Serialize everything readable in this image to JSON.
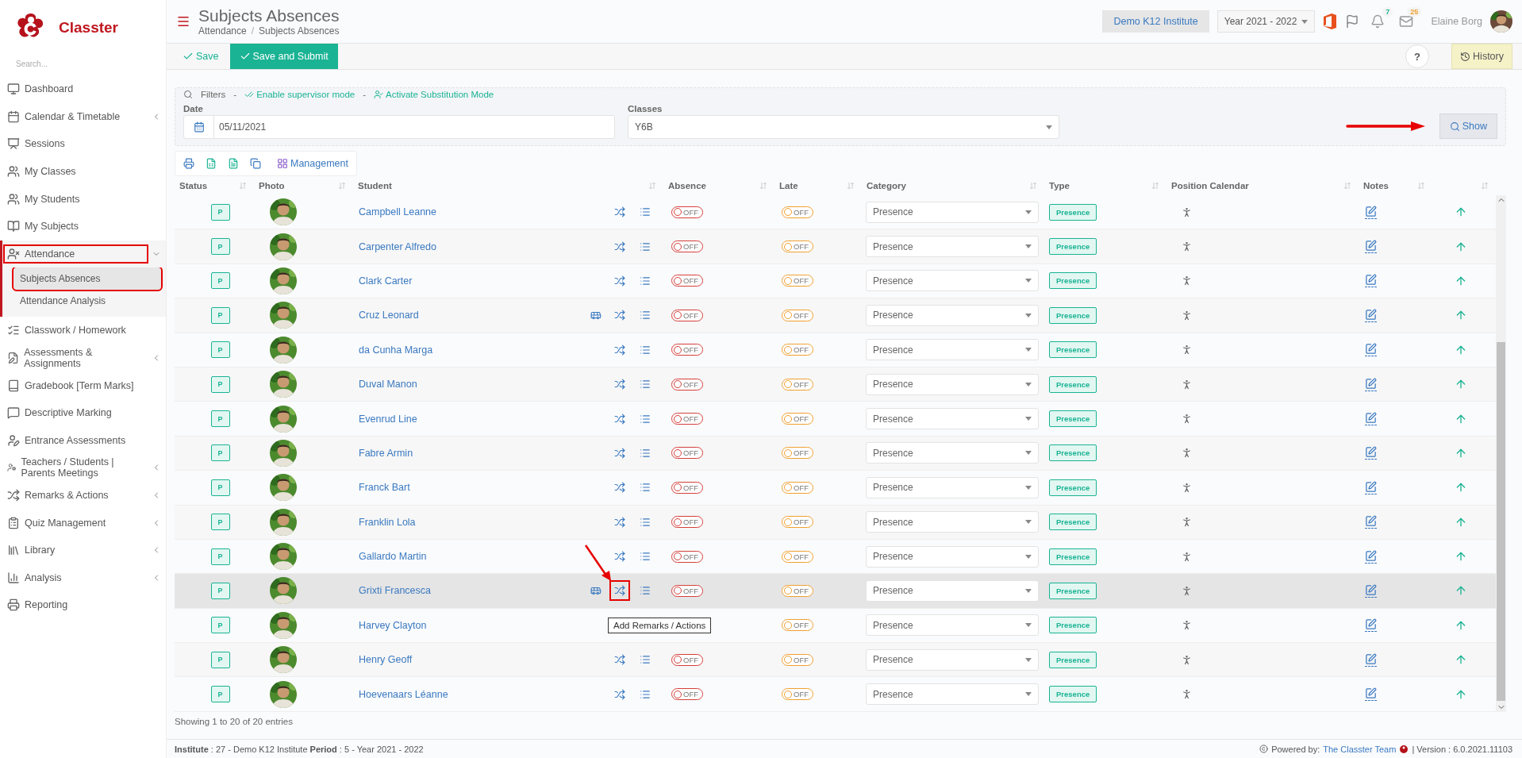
{
  "sidebar": {
    "logo": "Classter",
    "search": {
      "placeholder": "Search..."
    },
    "items": [
      {
        "label": "Dashboard",
        "kind": "link",
        "selected": false,
        "annotated": false
      },
      {
        "label": "Calendar & Timetable",
        "kind": "group",
        "expanded": false,
        "selected": false,
        "annotated": false
      },
      {
        "label": "Sessions",
        "kind": "link",
        "selected": false,
        "annotated": false
      },
      {
        "label": "My Classes",
        "kind": "link",
        "selected": false,
        "annotated": false
      },
      {
        "label": "My Students",
        "kind": "link",
        "selected": false,
        "annotated": false
      },
      {
        "label": "My Subjects",
        "kind": "link",
        "selected": false,
        "annotated": false
      },
      {
        "label": "Attendance",
        "kind": "group",
        "expanded": true,
        "selected": true,
        "annotated": true,
        "children": [
          {
            "label": "Subjects Absences",
            "selected": true,
            "annotated": true
          },
          {
            "label": "Attendance Analysis",
            "selected": false,
            "annotated": false
          }
        ]
      },
      {
        "label": "Classwork / Homework",
        "kind": "link",
        "selected": false,
        "annotated": false
      },
      {
        "label": "Assessments & Assignments",
        "kind": "group",
        "expanded": false,
        "selected": false,
        "annotated": false
      },
      {
        "label": "Gradebook [Term Marks]",
        "kind": "link",
        "selected": false,
        "annotated": false
      },
      {
        "label": "Descriptive Marking",
        "kind": "link",
        "selected": false,
        "annotated": false
      },
      {
        "label": "Entrance Assessments",
        "kind": "link",
        "selected": false,
        "annotated": false
      },
      {
        "label": "Teachers / Students | Parents Meetings",
        "kind": "group",
        "expanded": false,
        "selected": false,
        "annotated": false
      },
      {
        "label": "Remarks & Actions",
        "kind": "group",
        "expanded": false,
        "selected": false,
        "annotated": false
      },
      {
        "label": "Quiz Management",
        "kind": "group",
        "expanded": false,
        "selected": false,
        "annotated": false
      },
      {
        "label": "Library",
        "kind": "group",
        "expanded": false,
        "selected": false,
        "annotated": false
      },
      {
        "label": "Analysis",
        "kind": "group",
        "expanded": false,
        "selected": false,
        "annotated": false
      },
      {
        "label": "Reporting",
        "kind": "link",
        "selected": false,
        "annotated": false
      }
    ]
  },
  "header": {
    "title": "Subjects Absences",
    "breadcrumb": [
      "Attendance",
      "Subjects Absences"
    ],
    "breadcrumb_separator": "/",
    "institute": "Demo K12 Institute",
    "year": "Year 2021 - 2022",
    "notifications": "7",
    "messages": "25",
    "user": "Elaine Borg"
  },
  "toolbar": {
    "save": "Save",
    "submit": "Save and Submit",
    "help": "?",
    "history": "History"
  },
  "filters": {
    "title": "Filters",
    "separators": [
      "-",
      "-"
    ],
    "supervisor": "Enable supervisor mode",
    "substitution": "Activate Substitution Mode",
    "fields": [
      {
        "label": "Date",
        "value": "05/11/2021",
        "kind": "date"
      },
      {
        "label": "Classes",
        "value": "Y6B",
        "kind": "select"
      }
    ],
    "show": "Show",
    "show_annotated": true
  },
  "table_tools": {
    "management": "Management"
  },
  "table": {
    "columns": [
      "Status",
      "Photo",
      "Student",
      "",
      "Absence",
      "Late",
      "Category",
      "Type",
      "Position Calendar",
      "Notes",
      ""
    ],
    "rows": [
      {
        "status": "P",
        "student": "Campbell Leanne",
        "bus": false,
        "absence": {
          "label": "OFF",
          "on": false
        },
        "late": {
          "label": "OFF",
          "on": false
        },
        "category": "Presence",
        "type": "Presence",
        "hovered": false
      },
      {
        "status": "P",
        "student": "Carpenter Alfredo",
        "bus": false,
        "absence": {
          "label": "OFF",
          "on": false
        },
        "late": {
          "label": "OFF",
          "on": false
        },
        "category": "Presence",
        "type": "Presence",
        "hovered": false
      },
      {
        "status": "P",
        "student": "Clark Carter",
        "bus": false,
        "absence": {
          "label": "OFF",
          "on": false
        },
        "late": {
          "label": "OFF",
          "on": false
        },
        "category": "Presence",
        "type": "Presence",
        "hovered": false
      },
      {
        "status": "P",
        "student": "Cruz Leonard",
        "bus": true,
        "absence": {
          "label": "OFF",
          "on": false
        },
        "late": {
          "label": "OFF",
          "on": false
        },
        "category": "Presence",
        "type": "Presence",
        "hovered": false
      },
      {
        "status": "P",
        "student": "da Cunha Marga",
        "bus": false,
        "absence": {
          "label": "OFF",
          "on": false
        },
        "late": {
          "label": "OFF",
          "on": false
        },
        "category": "Presence",
        "type": "Presence",
        "hovered": false
      },
      {
        "status": "P",
        "student": "Duval Manon",
        "bus": false,
        "absence": {
          "label": "OFF",
          "on": false
        },
        "late": {
          "label": "OFF",
          "on": false
        },
        "category": "Presence",
        "type": "Presence",
        "hovered": false
      },
      {
        "status": "P",
        "student": "Evenrud Line",
        "bus": false,
        "absence": {
          "label": "OFF",
          "on": false
        },
        "late": {
          "label": "OFF",
          "on": false
        },
        "category": "Presence",
        "type": "Presence",
        "hovered": false
      },
      {
        "status": "P",
        "student": "Fabre Armin",
        "bus": false,
        "absence": {
          "label": "OFF",
          "on": false
        },
        "late": {
          "label": "OFF",
          "on": false
        },
        "category": "Presence",
        "type": "Presence",
        "hovered": false
      },
      {
        "status": "P",
        "student": "Franck Bart",
        "bus": false,
        "absence": {
          "label": "OFF",
          "on": false
        },
        "late": {
          "label": "OFF",
          "on": false
        },
        "category": "Presence",
        "type": "Presence",
        "hovered": false
      },
      {
        "status": "P",
        "student": "Franklin Lola",
        "bus": false,
        "absence": {
          "label": "OFF",
          "on": false
        },
        "late": {
          "label": "OFF",
          "on": false
        },
        "category": "Presence",
        "type": "Presence",
        "hovered": false
      },
      {
        "status": "P",
        "student": "Gallardo Martin",
        "bus": false,
        "absence": {
          "label": "OFF",
          "on": false
        },
        "late": {
          "label": "OFF",
          "on": false
        },
        "category": "Presence",
        "type": "Presence",
        "hovered": false
      },
      {
        "status": "P",
        "student": "Grixti Francesca",
        "bus": true,
        "absence": {
          "label": "OFF",
          "on": false
        },
        "late": {
          "label": "OFF",
          "on": false
        },
        "category": "Presence",
        "type": "Presence",
        "hovered": true,
        "tooltip": "Add Remarks / Actions"
      },
      {
        "status": "P",
        "student": "Harvey Clayton",
        "bus": false,
        "late": {
          "label": "OFF",
          "on": false
        },
        "category": "Presence",
        "type": "Presence",
        "hovered": false
      },
      {
        "status": "P",
        "student": "Henry Geoff",
        "bus": false,
        "absence": {
          "label": "OFF",
          "on": false
        },
        "late": {
          "label": "OFF",
          "on": false
        },
        "category": "Presence",
        "type": "Presence",
        "hovered": false
      },
      {
        "status": "P",
        "student": "Hoevenaars Léanne",
        "bus": false,
        "absence": {
          "label": "OFF",
          "on": false
        },
        "late": {
          "label": "OFF",
          "on": false
        },
        "category": "Presence",
        "type": "Presence",
        "hovered": false
      }
    ],
    "info": "Showing 1 to 20 of 20 entries"
  },
  "footer": {
    "info": "**Institute** : 27 - Demo K12 Institute **Period** : 5 - Year 2021 - 2022",
    "powered": "Powered by:",
    "team": "The Classter Team",
    "version": "| Version : 6.0.2021.11103"
  }
}
